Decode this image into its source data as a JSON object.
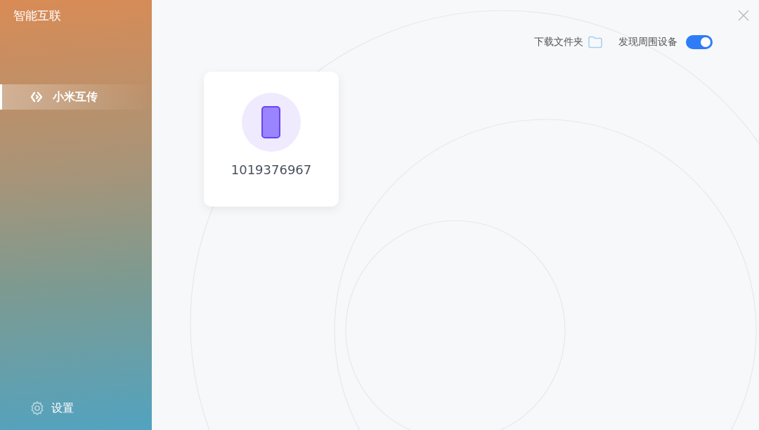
{
  "app_title": "智能互联",
  "sidebar": {
    "items": [
      {
        "label": "小米互传",
        "selected": true
      }
    ],
    "settings": {
      "label": "设置"
    }
  },
  "toolbar": {
    "download_folder": {
      "label": "下载文件夹"
    },
    "discover": {
      "label": "发现周围设备",
      "on": true
    }
  },
  "devices": [
    {
      "name": "1019376967"
    }
  ]
}
